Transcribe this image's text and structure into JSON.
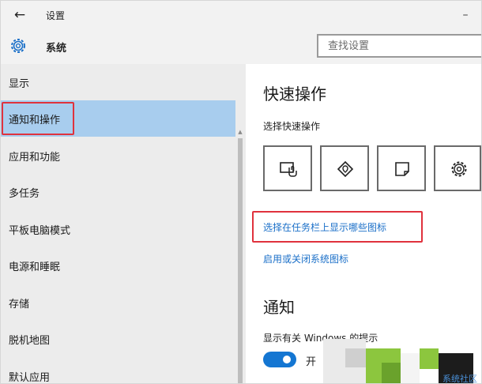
{
  "titlebar": {
    "back_icon": "←",
    "title": "设置",
    "minimize_icon": "–"
  },
  "header": {
    "section_title": "系统",
    "search_placeholder": "查找设置"
  },
  "sidebar": {
    "items": [
      {
        "label": "显示",
        "selected": false
      },
      {
        "label": "通知和操作",
        "selected": true
      },
      {
        "label": "应用和功能",
        "selected": false
      },
      {
        "label": "多任务",
        "selected": false
      },
      {
        "label": "平板电脑模式",
        "selected": false
      },
      {
        "label": "电源和睡眠",
        "selected": false
      },
      {
        "label": "存储",
        "selected": false
      },
      {
        "label": "脱机地图",
        "selected": false
      },
      {
        "label": "默认应用",
        "selected": false
      }
    ],
    "highlight_color": "#a8cdee"
  },
  "content": {
    "quick_actions_heading": "快速操作",
    "quick_actions_subtitle": "选择快速操作",
    "quick_action_tiles": [
      {
        "icon": "tablet-mode-icon"
      },
      {
        "icon": "location-icon"
      },
      {
        "icon": "note-icon"
      },
      {
        "icon": "settings-gear-icon"
      }
    ],
    "taskbar_icons_link": "选择在任务栏上显示哪些图标",
    "system_icons_link": "启用或关闭系统图标",
    "notifications_heading": "通知",
    "show_tips_text": "显示有关 Windows 的提示",
    "toggle_state": "开",
    "link_color": "#1a6fc8",
    "toggle_color": "#1476d2"
  },
  "watermark": {
    "text": "系统社区"
  },
  "annotation_color": "#e0323d"
}
